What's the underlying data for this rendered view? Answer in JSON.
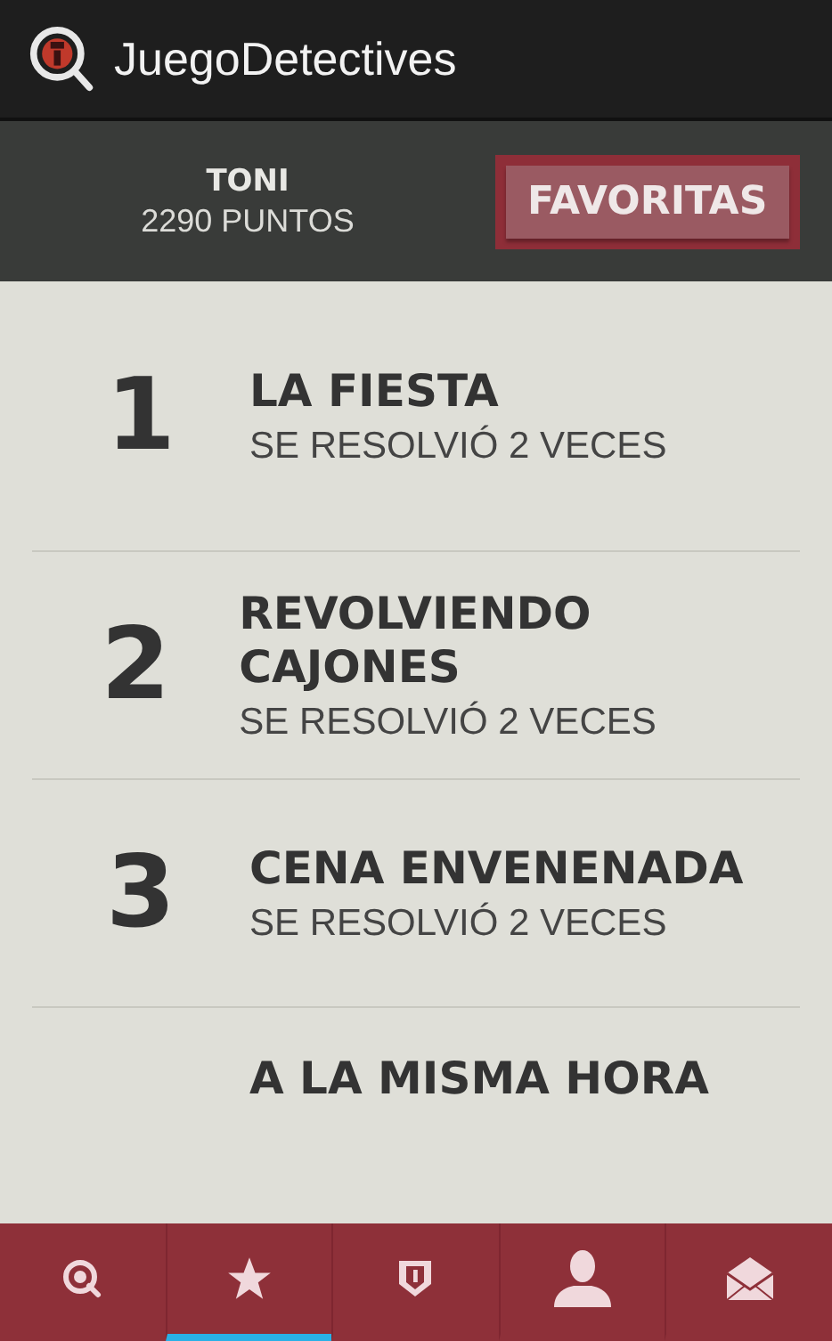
{
  "app_bar": {
    "title": "JuegoDetectives"
  },
  "profile": {
    "name": "TONI",
    "points": "2290 PUNTOS",
    "button": "FAVORITAS"
  },
  "cases": [
    {
      "number": "1",
      "title": "LA FIESTA",
      "subtitle": "SE RESOLVIÓ 2 VECES"
    },
    {
      "number": "2",
      "title": "REVOLVIENDO CAJONES",
      "subtitle": "SE RESOLVIÓ 2 VECES"
    },
    {
      "number": "3",
      "title": "CENA ENVENENADA",
      "subtitle": "SE RESOLVIÓ 2 VECES"
    },
    {
      "title": "A LA MISMA HORA"
    }
  ],
  "tabs": [
    {
      "kind": "detective",
      "selected": false
    },
    {
      "kind": "star",
      "selected": true
    },
    {
      "kind": "badge",
      "selected": false
    },
    {
      "kind": "person",
      "selected": false
    },
    {
      "kind": "mail",
      "selected": false
    }
  ]
}
